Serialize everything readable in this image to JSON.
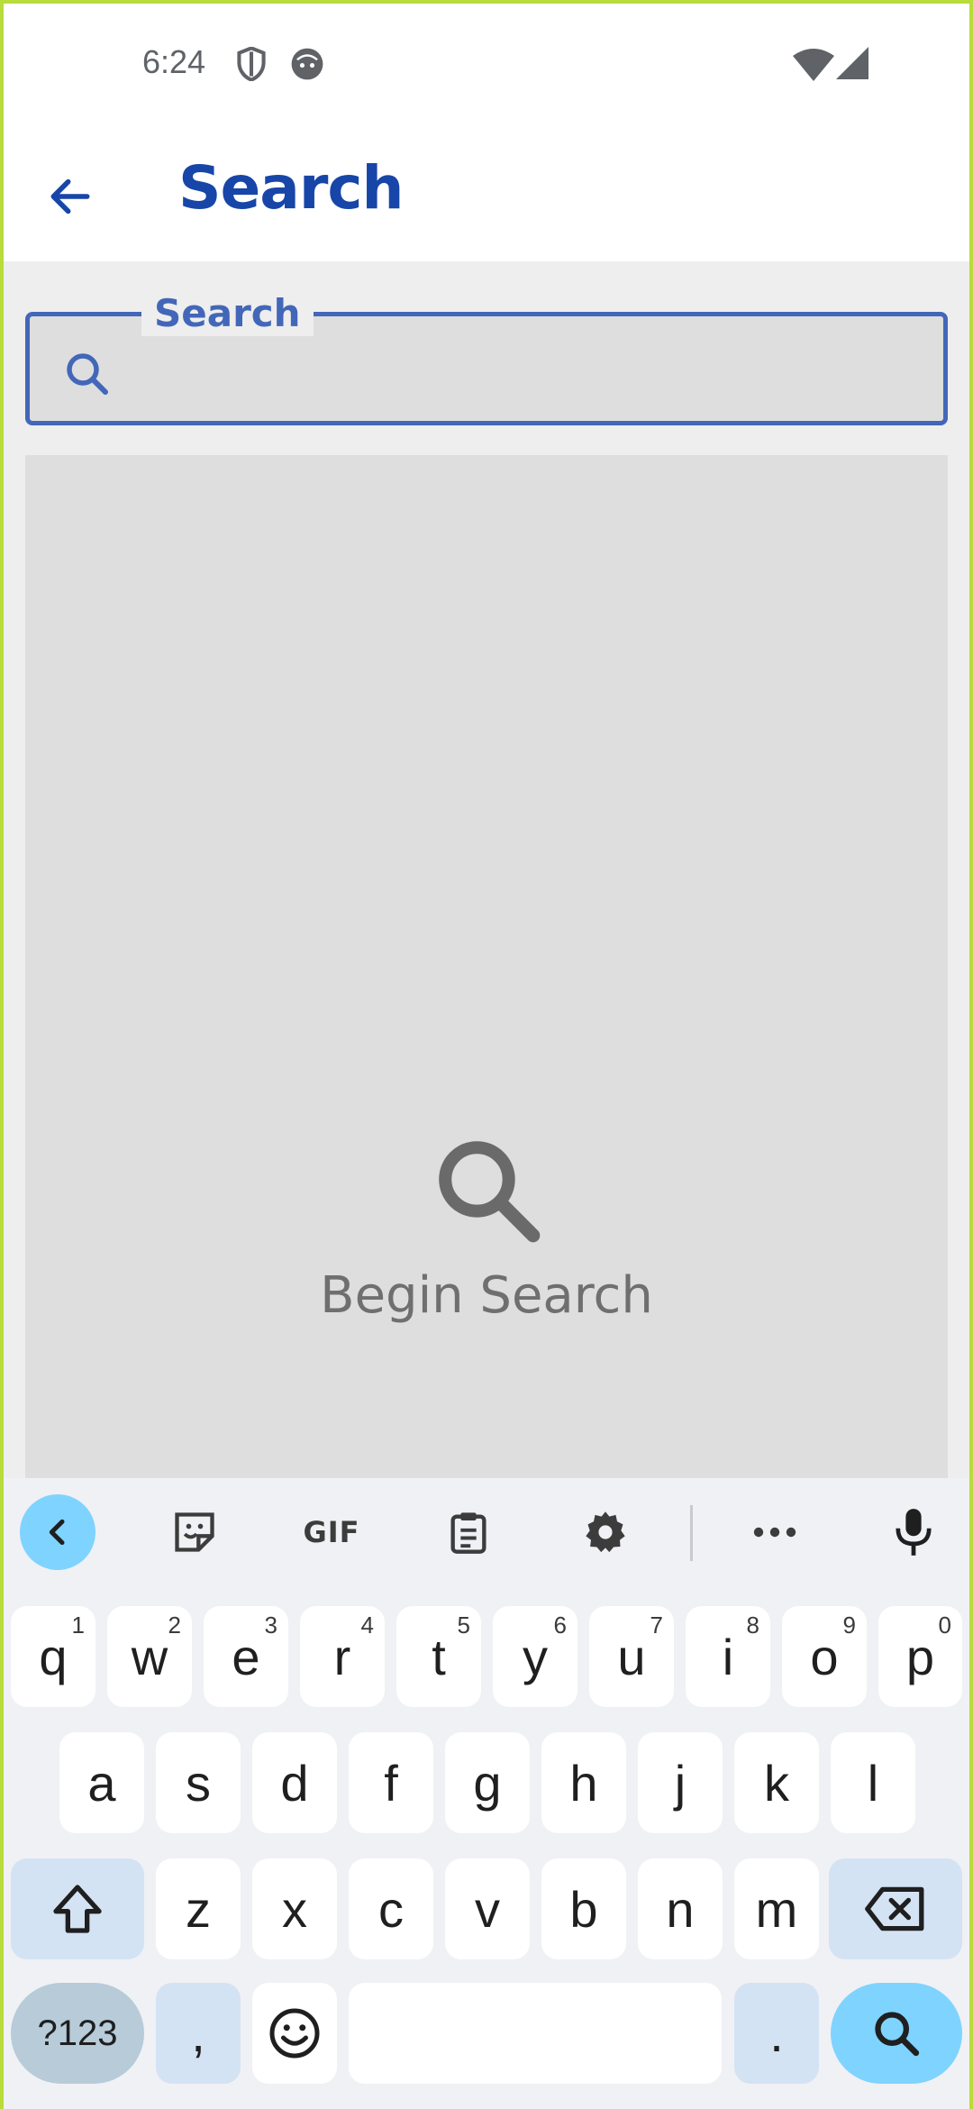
{
  "status": {
    "time": "6:24",
    "icons": [
      "shield-icon",
      "face-icon",
      "wifi-icon",
      "signal-icon"
    ]
  },
  "app_bar": {
    "title": "Search",
    "back_icon": "arrow-left-icon"
  },
  "search": {
    "label": "Search",
    "value": "",
    "placeholder": ""
  },
  "empty_state": {
    "icon": "search-icon",
    "text": "Begin Search"
  },
  "keyboard": {
    "toolbar": [
      "back-icon",
      "sticker-icon",
      "GIF",
      "clipboard-icon",
      "settings-icon",
      "more-icon",
      "mic-icon"
    ],
    "gif_label": "GIF",
    "row1": [
      {
        "k": "q",
        "h": "1"
      },
      {
        "k": "w",
        "h": "2"
      },
      {
        "k": "e",
        "h": "3"
      },
      {
        "k": "r",
        "h": "4"
      },
      {
        "k": "t",
        "h": "5"
      },
      {
        "k": "y",
        "h": "6"
      },
      {
        "k": "u",
        "h": "7"
      },
      {
        "k": "i",
        "h": "8"
      },
      {
        "k": "o",
        "h": "9"
      },
      {
        "k": "p",
        "h": "0"
      }
    ],
    "row2": [
      "a",
      "s",
      "d",
      "f",
      "g",
      "h",
      "j",
      "k",
      "l"
    ],
    "row3": [
      "z",
      "x",
      "c",
      "v",
      "b",
      "n",
      "m"
    ],
    "symbols_label": "?123",
    "comma": ",",
    "period": ".",
    "accent_color": "#7fd3ff",
    "title_color": "#1746a8",
    "field_color": "#4367b8"
  }
}
